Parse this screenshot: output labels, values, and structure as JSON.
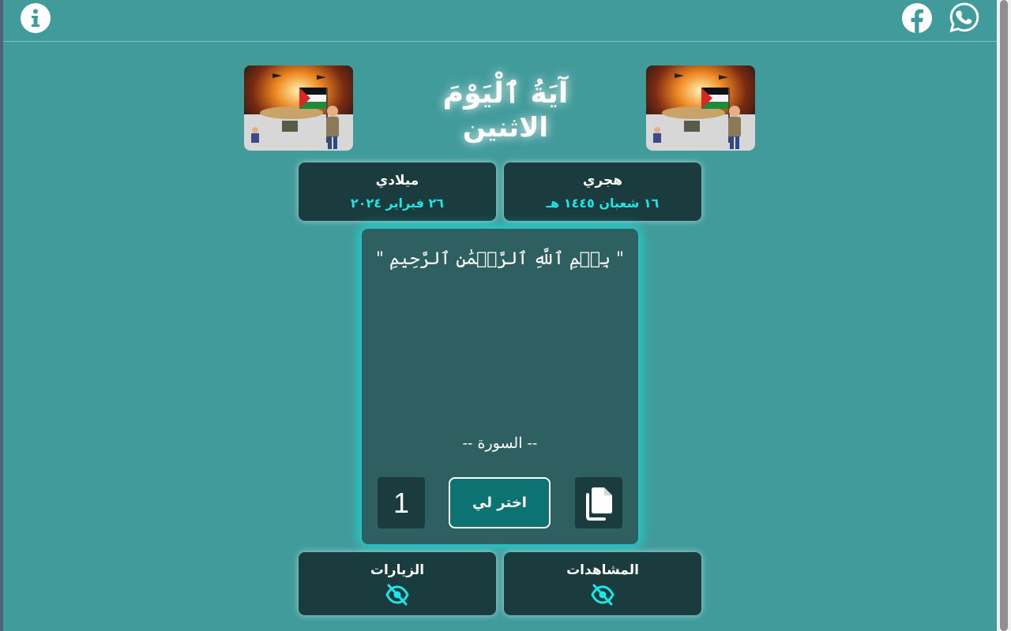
{
  "header": {
    "info_icon": "info-icon",
    "facebook_icon": "facebook-icon",
    "whatsapp_icon": "whatsapp-icon"
  },
  "title": {
    "line1": "آيَةُ ٱلْيَوْمَ",
    "day": "الاثنين"
  },
  "images": {
    "left": "palestine-flag-image",
    "right": "palestine-flag-image"
  },
  "dates": {
    "miladi": {
      "label": "ميلادي",
      "value": "٢٦ فبراير ٢٠٢٤"
    },
    "hijri": {
      "label": "هجري",
      "value": "١٦ شعبان ١٤٤٥ هـ"
    }
  },
  "ayah": {
    "text": "\" بِسۡمِ ٱللَّهِ ٱلرَّحۡمَٰنِ ٱلرَّحِيمِ \"",
    "surah": "-- السورة --",
    "counter": "1",
    "choose_label": "اختر لي",
    "copy_icon": "copy-icon"
  },
  "stats": {
    "visits": {
      "label": "الزيارات",
      "icon": "eye-slash-icon"
    },
    "views": {
      "label": "المشاهدات",
      "icon": "eye-slash-icon"
    }
  },
  "colors": {
    "background": "#429b9b",
    "card": "#1a3c3e",
    "accent": "#1ee6e6",
    "ayah_card": "#2e5f61",
    "button": "#0d7272"
  }
}
